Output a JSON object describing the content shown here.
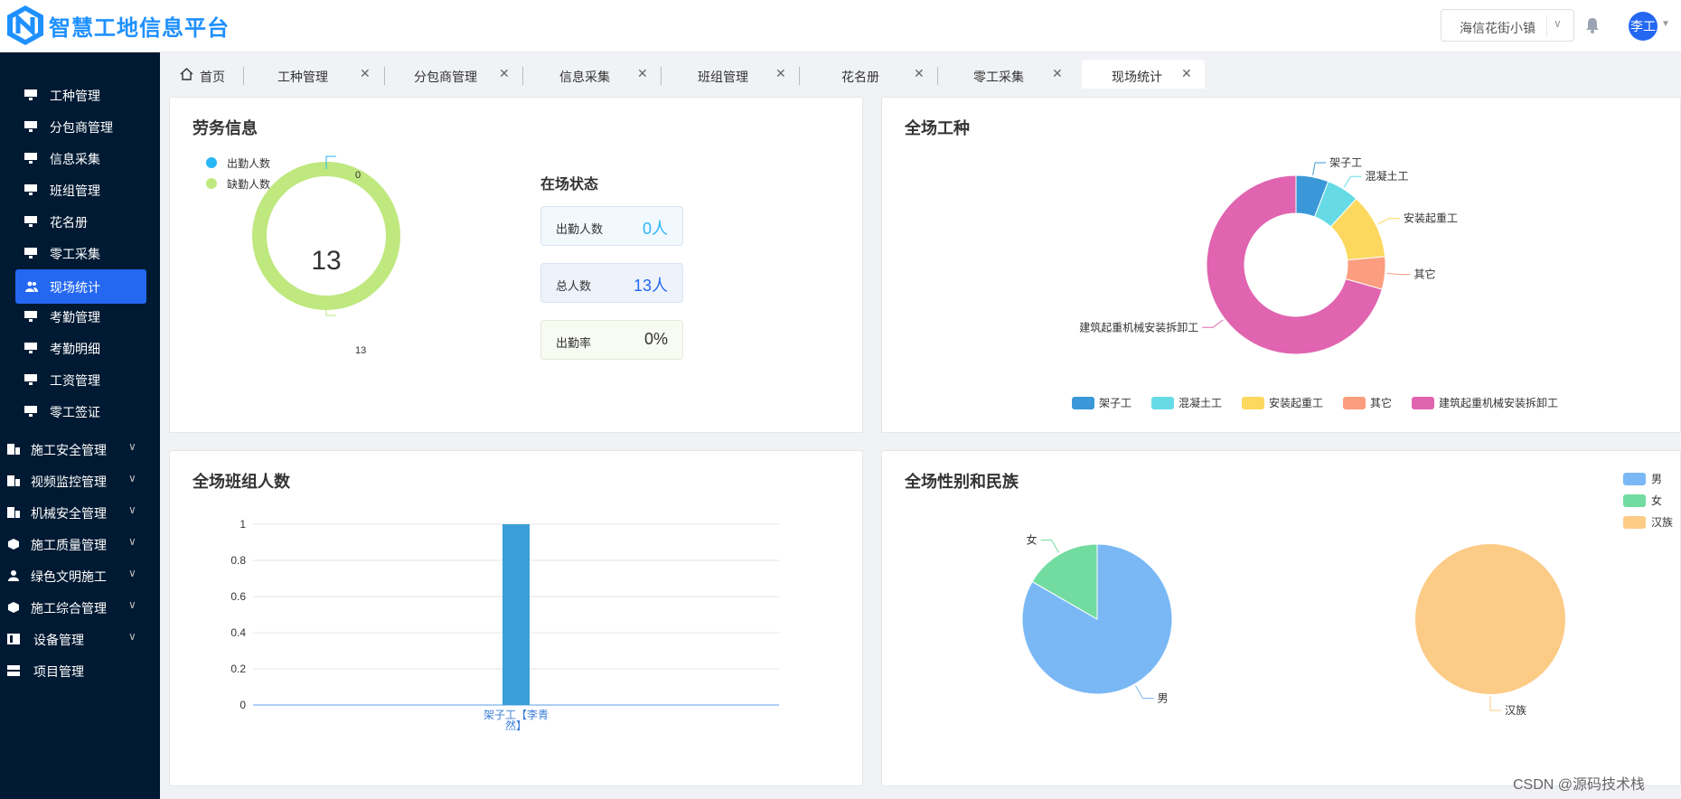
{
  "header": {
    "app_title": "智慧工地信息平台",
    "site_select": "海信花街小镇",
    "user": "李工"
  },
  "sidebar": {
    "items": [
      "工种管理",
      "分包商管理",
      "信息采集",
      "班组管理",
      "花名册",
      "零工采集",
      "现场统计",
      "考勤管理",
      "考勤明细",
      "工资管理",
      "零工签证"
    ],
    "groups": [
      "施工安全管理",
      "视频监控管理",
      "机械安全管理",
      "施工质量管理",
      "绿色文明施工",
      "施工综合管理",
      "设备管理",
      "项目管理"
    ]
  },
  "tabs": [
    "首页",
    "工种管理",
    "分包商管理",
    "信息采集",
    "班组管理",
    "花名册",
    "零工采集",
    "现场统计"
  ],
  "labor": {
    "title": "劳务信息",
    "legend": [
      "出勤人数",
      "缺勤人数"
    ],
    "center_value": "13",
    "label_top": "0",
    "label_bottom": "13",
    "status_title": "在场状态",
    "stats": [
      {
        "k": "出勤人数",
        "v": "0人"
      },
      {
        "k": "总人数",
        "v": "13人"
      },
      {
        "k": "出勤率",
        "v": "0%"
      }
    ]
  },
  "colors": {
    "attend": "#29b6f6",
    "absent": "#bfe87e",
    "brand": "#2468f2"
  },
  "chart_data": [
    {
      "type": "pie",
      "title": "全场工种",
      "categories": [
        "架子工",
        "混凝土工",
        "安装起重工",
        "其它",
        "建筑起重机械安装拆卸工"
      ],
      "values": [
        1,
        1,
        2,
        1,
        12
      ],
      "colors": [
        "#3a98d8",
        "#66dbe6",
        "#fcd85f",
        "#fb9d7e",
        "#e064b0"
      ],
      "legend": "bottom"
    },
    {
      "type": "bar",
      "title": "全场班组人数",
      "categories": [
        "架子工【李青然】"
      ],
      "category_lines": [
        "架子工【李青",
        "然】"
      ],
      "values": [
        1
      ],
      "ylim": [
        0,
        1
      ],
      "yticks": [
        "0",
        "0.2",
        "0.4",
        "0.6",
        "0.8",
        "1"
      ],
      "grid": true
    },
    {
      "type": "pie",
      "title": "全场性别和民族",
      "legend_entries": [
        "男",
        "女",
        "汉族"
      ],
      "legend_colors": [
        "#7ab8f5",
        "#72dca0",
        "#fccb86"
      ],
      "pies": [
        {
          "categories": [
            "男",
            "女"
          ],
          "values": [
            10,
            2
          ],
          "colors": [
            "#7ab8f5",
            "#72dca0"
          ]
        },
        {
          "categories": [
            "汉族"
          ],
          "values": [
            13
          ],
          "colors": [
            "#fccb86"
          ]
        }
      ],
      "legend": "top-right"
    }
  ],
  "watermark": "CSDN @源码技术栈"
}
